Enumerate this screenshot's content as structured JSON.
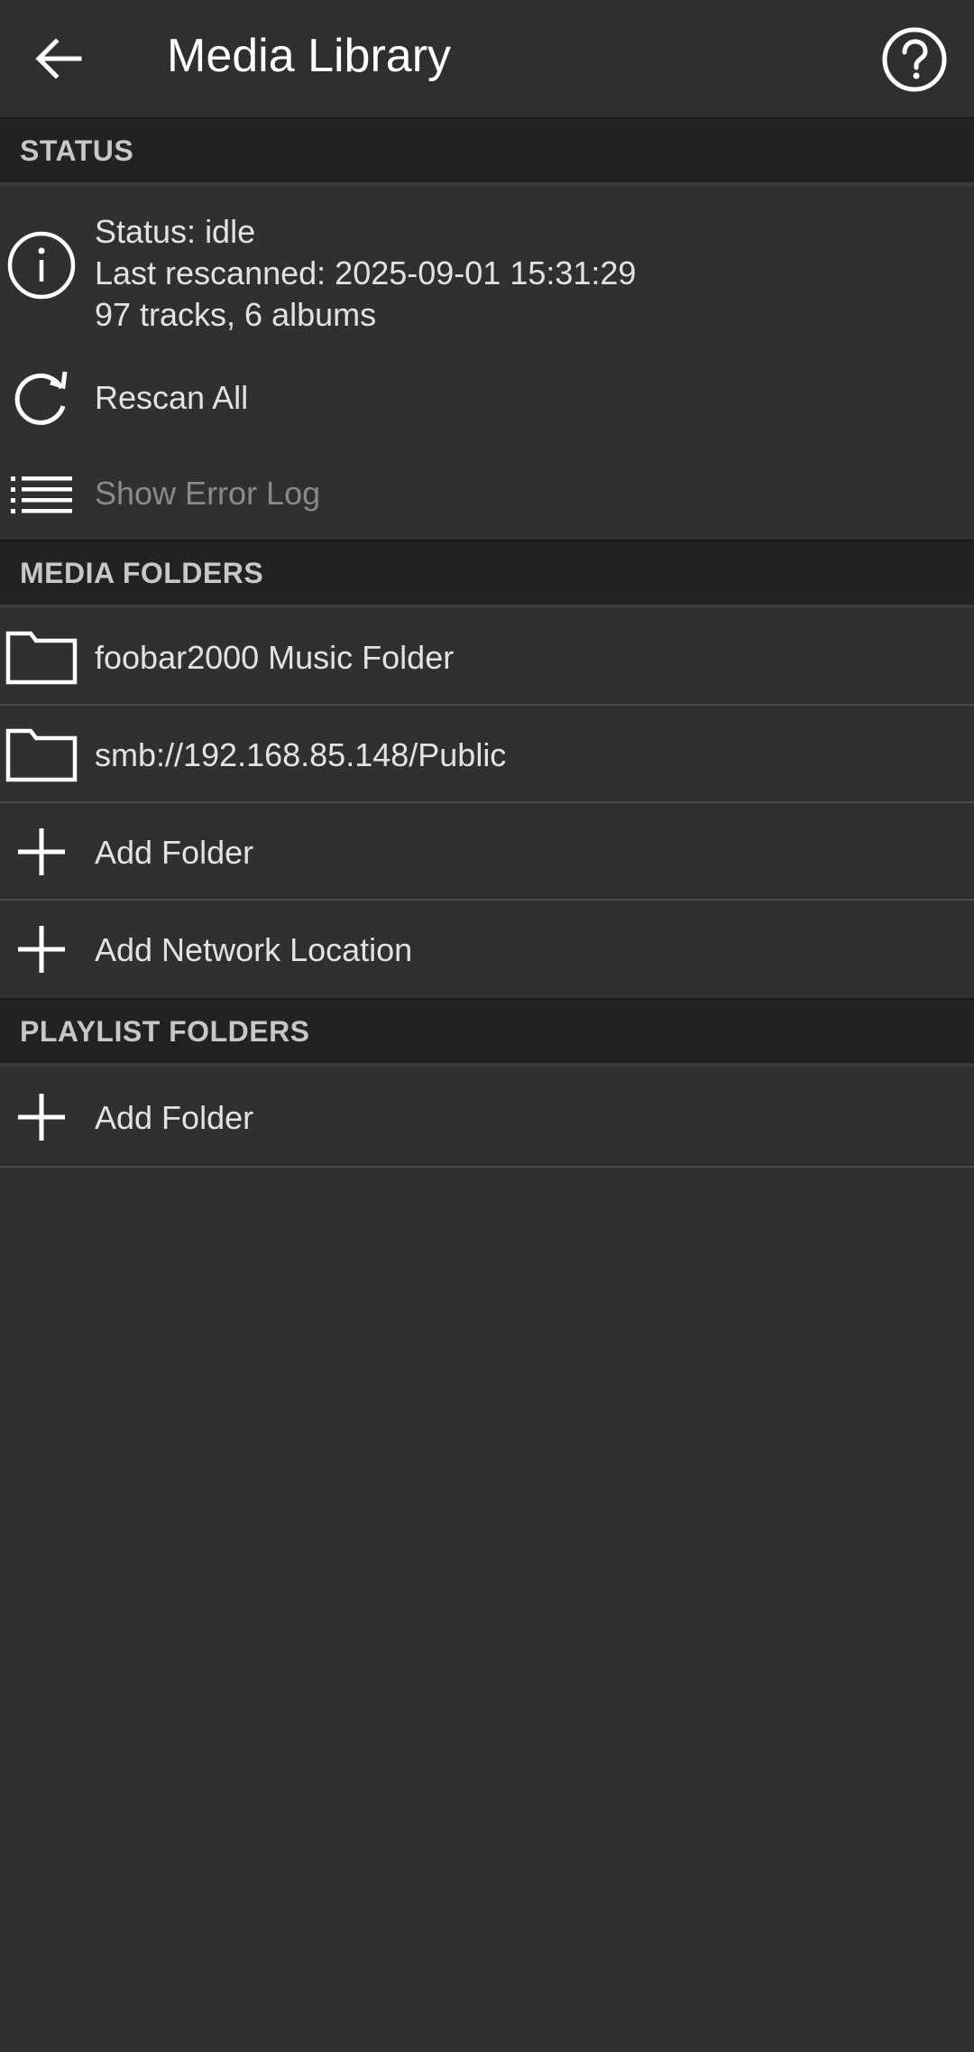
{
  "header": {
    "title": "Media Library",
    "back_icon": "arrow-left-icon",
    "help_icon": "help-circle-icon"
  },
  "status_section": {
    "heading": "STATUS",
    "status_line": "Status: idle",
    "rescanned_line": "Last rescanned: 2025-09-01 15:31:29",
    "counts_line": "97 tracks, 6 albums",
    "rescan_label": "Rescan All",
    "error_log_label": "Show Error Log"
  },
  "media_folders": {
    "heading": "MEDIA FOLDERS",
    "items": [
      {
        "label": "foobar2000 Music Folder",
        "icon": "folder-icon"
      },
      {
        "label": "smb://192.168.85.148/Public",
        "icon": "folder-icon"
      }
    ],
    "add_folder_label": "Add Folder",
    "add_network_label": "Add Network Location"
  },
  "playlist_folders": {
    "heading": "PLAYLIST FOLDERS",
    "add_folder_label": "Add Folder"
  },
  "colors": {
    "background": "#303030",
    "section_header_bg": "#222222",
    "text": "#e3e3e3",
    "disabled_text": "#8a8a8a"
  }
}
